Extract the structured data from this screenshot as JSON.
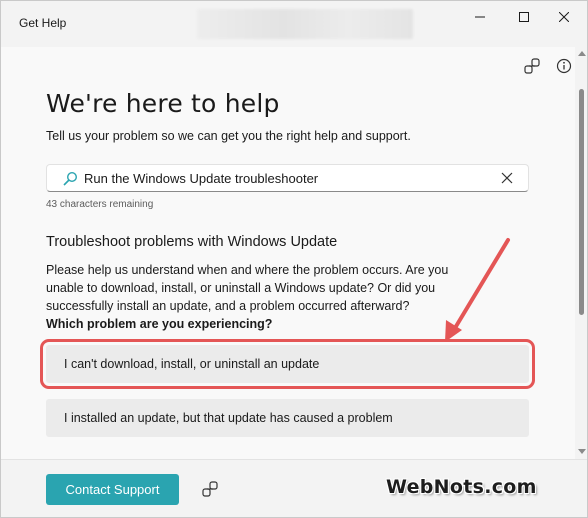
{
  "window": {
    "app_title": "Get Help",
    "controls": {
      "minimize_icon": "minimize-icon",
      "maximize_icon": "maximize-icon",
      "close_icon": "close-icon"
    }
  },
  "header_icons": [
    "link-icon",
    "info-icon"
  ],
  "main": {
    "heading": "We're here to help",
    "subtitle": "Tell us your problem so we can get you the right help and support.",
    "search": {
      "value": "Run the Windows Update troubleshooter",
      "char_count": "43 characters remaining"
    },
    "section_title": "Troubleshoot problems with Windows Update",
    "description": "Please help us understand when and where the problem occurs.  Are you unable to download, install, or uninstall a Windows update?  Or did you successfully install an update, and a problem occurred afterward?",
    "question": "Which problem are you experiencing?",
    "options": [
      {
        "label": "I can't download, install, or uninstall an update",
        "highlighted": true
      },
      {
        "label": "I installed an update, but that update has caused a problem",
        "highlighted": false
      }
    ]
  },
  "footer": {
    "contact_label": "Contact Support",
    "share_icon": "link-icon"
  },
  "watermark": "WebNots.com",
  "colors": {
    "accent": "#2aa4b0",
    "annotation": "#e45656"
  }
}
